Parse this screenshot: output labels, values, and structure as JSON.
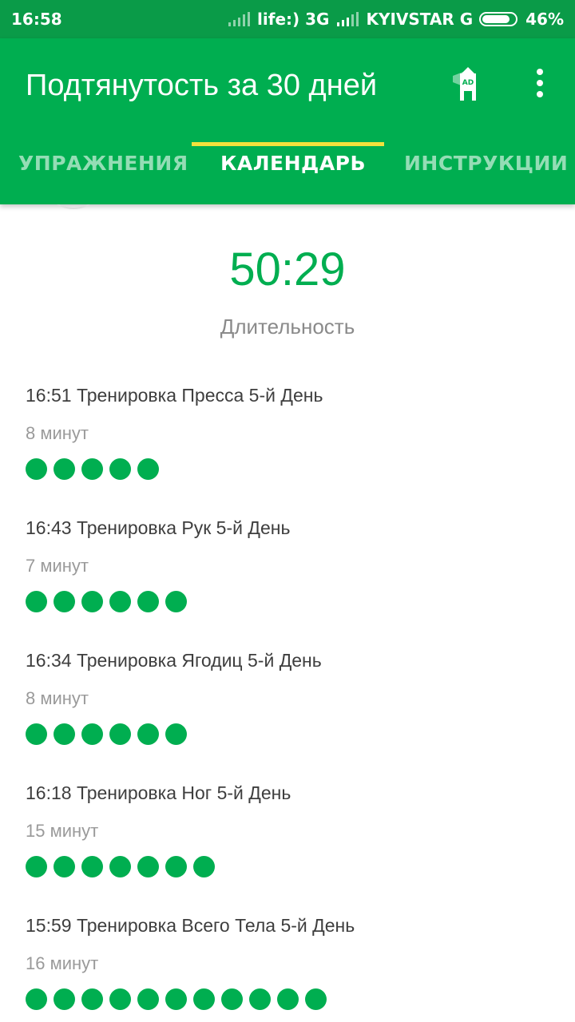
{
  "status_bar": {
    "time": "16:58",
    "carrier1": "life:) 3G",
    "carrier2": "KYIVSTAR G",
    "battery": "46%"
  },
  "app_bar": {
    "title": "Подтянутость за 30 дней",
    "ad_icon_label": "AD",
    "ad_icon": "ad-lighthouse-icon",
    "menu_icon": "more-vert-icon"
  },
  "tabs": [
    {
      "label": "УПРАЖНЕНИЯ",
      "active": false
    },
    {
      "label": "КАЛЕНДАРЬ",
      "active": true
    },
    {
      "label": "ИНСТРУКЦИИ",
      "active": false
    }
  ],
  "summary": {
    "duration_value": "50:29",
    "duration_label": "Длительность"
  },
  "workouts": [
    {
      "title": "16:51 Тренировка Пресса 5-й День",
      "minutes": "8 минут",
      "dots": 5
    },
    {
      "title": "16:43 Тренировка Рук 5-й День",
      "minutes": "7 минут",
      "dots": 6
    },
    {
      "title": "16:34 Тренировка Ягодиц 5-й День",
      "minutes": "8 минут",
      "dots": 6
    },
    {
      "title": "16:18 Тренировка Ног 5-й День",
      "minutes": "15 минут",
      "dots": 7
    },
    {
      "title": "15:59 Тренировка Всего Тела 5-й День",
      "minutes": "16 минут",
      "dots": 11
    }
  ],
  "colors": {
    "status_bar": "#0a9b48",
    "primary": "#00ae50",
    "tab_indicator": "#f3e13c",
    "text_dark": "#3e3e3e",
    "text_muted": "#9a9a9a"
  }
}
